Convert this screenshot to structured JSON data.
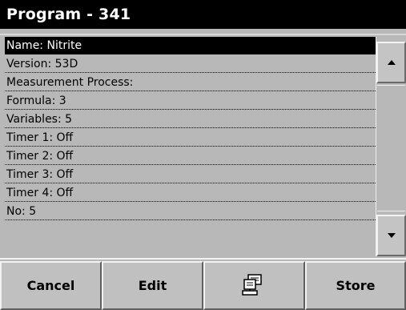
{
  "title": "Program - 341",
  "list": {
    "items": [
      {
        "label": "Name: Nitrite",
        "selected": true
      },
      {
        "label": "Version: 53D"
      },
      {
        "label": "Measurement Process:"
      },
      {
        "label": "Formula: 3"
      },
      {
        "label": "Variables: 5"
      },
      {
        "label": "Timer 1: Off"
      },
      {
        "label": "Timer 2: Off"
      },
      {
        "label": "Timer 3: Off"
      },
      {
        "label": "Timer 4: Off"
      },
      {
        "label": "No: 5"
      }
    ]
  },
  "scrollbar": {
    "up_icon": "arrow-up-icon",
    "down_icon": "arrow-down-icon"
  },
  "softkeys": {
    "cancel_label": "Cancel",
    "edit_label": "Edit",
    "computer_icon": "computer-icon",
    "store_label": "Store"
  }
}
